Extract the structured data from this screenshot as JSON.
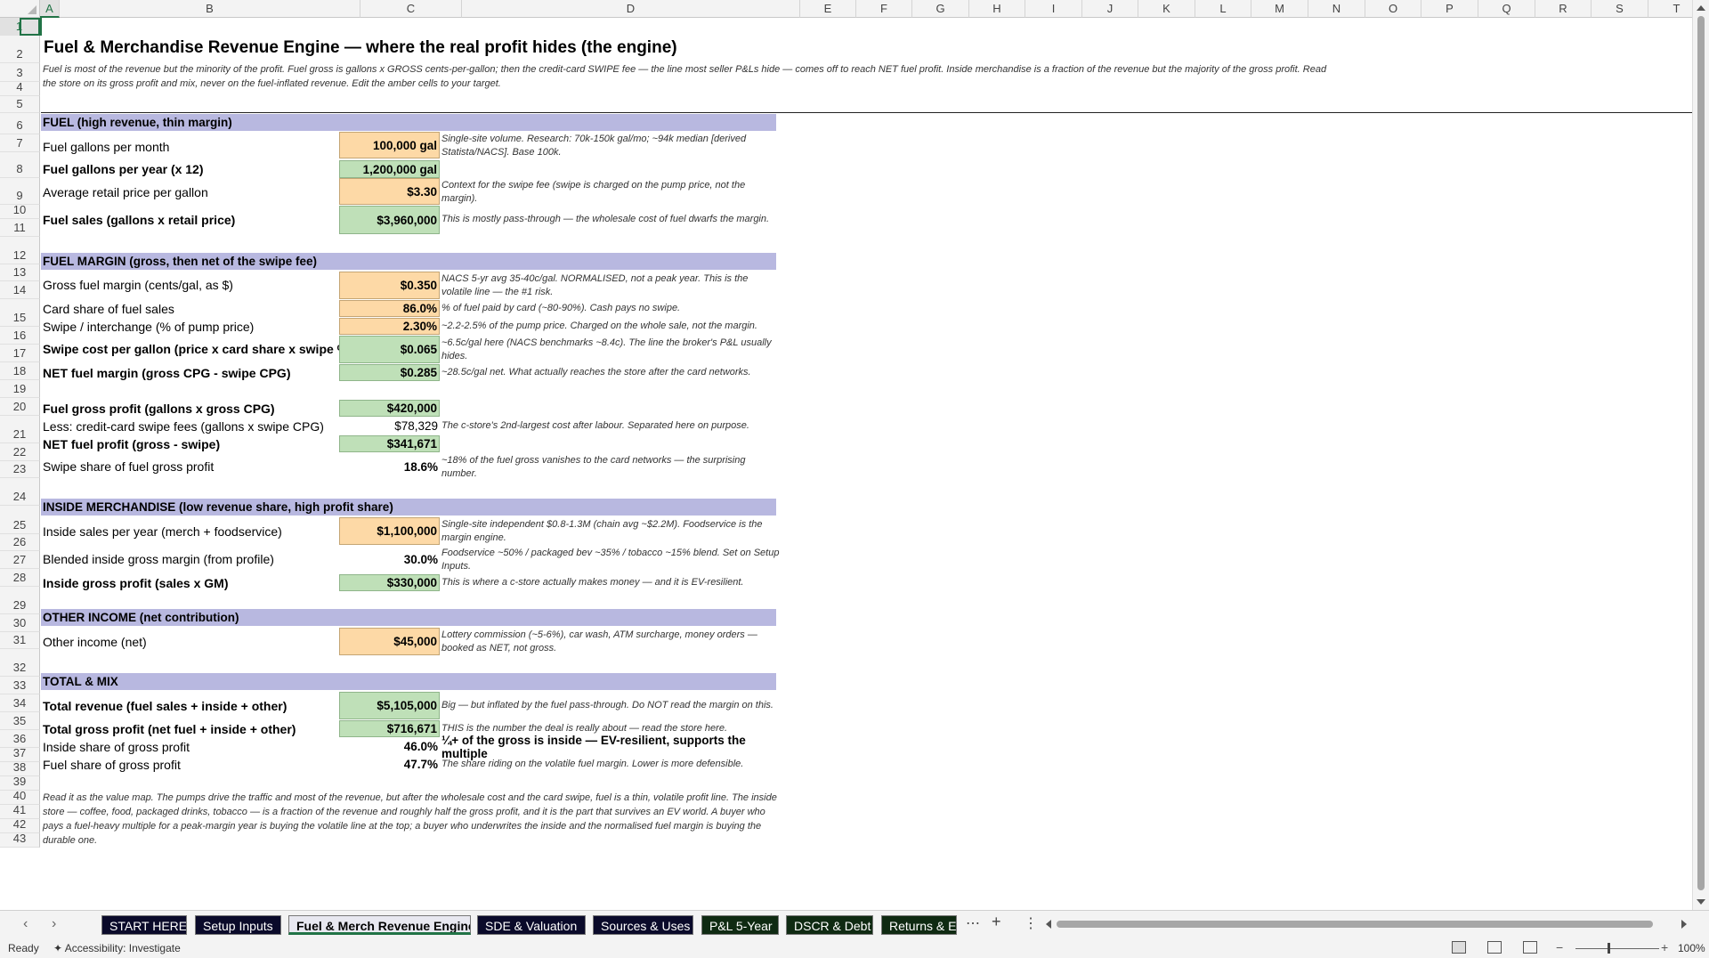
{
  "sheet": {
    "columns": [
      "A",
      "B",
      "C",
      "D",
      "E",
      "F",
      "G",
      "H",
      "I",
      "J",
      "K",
      "L",
      "M",
      "N",
      "O",
      "P",
      "Q",
      "R",
      "S",
      "T"
    ],
    "rows": [
      "1",
      "2",
      "3",
      "4",
      "5",
      "6",
      "7",
      "8",
      "9",
      "10",
      "11",
      "12",
      "13",
      "14",
      "15",
      "16",
      "17",
      "18",
      "19",
      "20",
      "21",
      "22",
      "23",
      "24",
      "25",
      "26",
      "27",
      "28",
      "29",
      "30",
      "31",
      "32",
      "33",
      "34",
      "35",
      "36",
      "37",
      "38",
      "39",
      "40",
      "41",
      "42",
      "43"
    ],
    "title": "Fuel & Merchandise Revenue Engine — where the real profit hides (the engine)",
    "subtitle": "Fuel is most of the revenue but the minority of the profit. Fuel gross is gallons x GROSS cents-per-gallon; then the credit-card SWIPE fee — the line most seller P&Ls hide — comes off to reach NET fuel profit. Inside merchandise is a fraction of the revenue but the majority of the gross profit. Read the store on its gross profit and mix, never on the fuel-inflated revenue. Edit the amber cells to your target.",
    "closing_note": "Read it as the value map. The pumps drive the traffic and most of the revenue, but after the wholesale cost and the card swipe, fuel is a thin, volatile profit line. The inside store — coffee, food, packaged drinks, tobacco — is a fraction of the revenue and roughly half the gross profit, and it is the part that survives an EV world. A buyer who pays a fuel-heavy multiple for a peak-margin year is buying the volatile line at the top; a buyer who underwrites the inside and the normalised fuel margin is buying the durable one."
  },
  "sections": {
    "fuel": "FUEL  (high revenue, thin margin)",
    "fuel_margin": "FUEL MARGIN  (gross, then net of the swipe fee)",
    "inside": "INSIDE MERCHANDISE  (low revenue share, high profit share)",
    "other": "OTHER INCOME  (net contribution)",
    "total": "TOTAL & MIX"
  },
  "rows": {
    "r6": {
      "label": "Fuel gallons per month",
      "value": "100,000 gal",
      "note": "Single-site volume. Research: 70k-150k gal/mo; ~94k median [derived Statista/NACS]. Base 100k."
    },
    "r7": {
      "label": "Fuel gallons per year (x 12)",
      "value": "1,200,000 gal",
      "note": ""
    },
    "r8": {
      "label": "Average retail price per gallon",
      "value": "$3.30",
      "note": "Context for the swipe fee (swipe is charged on the pump price, not the margin)."
    },
    "r9": {
      "label": "Fuel sales (gallons x retail price)",
      "value": "$3,960,000",
      "note": "This is mostly pass-through — the wholesale cost of fuel dwarfs the margin."
    },
    "r12": {
      "label": "Gross fuel margin (cents/gal, as $)",
      "value": "$0.350",
      "note": "NACS 5-yr avg 35-40c/gal. NORMALISED, not a peak year. This is the volatile line — the #1 risk."
    },
    "r13": {
      "label": "Card share of fuel sales",
      "value": "86.0%",
      "note": "% of fuel paid by card (~80-90%). Cash pays no swipe."
    },
    "r14": {
      "label": "Swipe / interchange (% of pump price)",
      "value": "2.30%",
      "note": "~2.2-2.5% of the pump price. Charged on the whole sale, not the margin."
    },
    "r15": {
      "label": "Swipe cost per gallon (price x card share x swipe %)",
      "value": "$0.065",
      "note": "~6.5c/gal here (NACS benchmarks ~8.4c). The line the broker's P&L usually hides."
    },
    "r16": {
      "label": "NET fuel margin (gross CPG - swipe CPG)",
      "value": "$0.285",
      "note": "~28.5c/gal net. What actually reaches the store after the card networks."
    },
    "r18": {
      "label": "Fuel gross profit (gallons x gross CPG)",
      "value": "$420,000",
      "note": ""
    },
    "r19": {
      "label": "Less: credit-card swipe fees (gallons x swipe CPG)",
      "value": "$78,329",
      "note": "The c-store's 2nd-largest cost after labour. Separated here on purpose."
    },
    "r20": {
      "label": "NET fuel profit (gross - swipe)",
      "value": "$341,671",
      "note": ""
    },
    "r21": {
      "label": "Swipe share of fuel gross profit",
      "value": "18.6%",
      "note": "~18% of the fuel gross vanishes to the card networks — the surprising number."
    },
    "r24": {
      "label": "Inside sales per year (merch + foodservice)",
      "value": "$1,100,000",
      "note": "Single-site independent $0.8-1.3M (chain avg ~$2.2M). Foodservice is the margin engine."
    },
    "r25": {
      "label": "Blended inside gross margin (from profile)",
      "value": "30.0%",
      "note": "Foodservice ~50% / packaged bev ~35% / tobacco ~15% blend. Set on Setup Inputs."
    },
    "r26": {
      "label": "Inside gross profit (sales x GM)",
      "value": "$330,000",
      "note": "This is where a c-store actually makes money — and it is EV-resilient."
    },
    "r29": {
      "label": "Other income (net)",
      "value": "$45,000",
      "note": "Lottery commission (~5-6%), car wash, ATM surcharge, money orders — booked as NET, not gross."
    },
    "r32": {
      "label": "Total revenue (fuel sales + inside + other)",
      "value": "$5,105,000",
      "note": "Big — but inflated by the fuel pass-through. Do NOT read the margin on this."
    },
    "r33": {
      "label": "Total gross profit (net fuel + inside + other)",
      "value": "$716,671",
      "note": "THIS is the number the deal is really about — read the store here."
    },
    "r34": {
      "label": "Inside share of gross profit",
      "value": "46.0%",
      "note": "¼+ of the gross is inside — EV-resilient, supports the multiple"
    },
    "r35": {
      "label": "Fuel share of gross profit",
      "value": "47.7%",
      "note": "The share riding on the volatile fuel margin. Lower is more defensible."
    }
  },
  "tabs": [
    {
      "label": "START HERE",
      "color": "#0a0a2a"
    },
    {
      "label": "Setup Inputs",
      "color": "#0a0a2a"
    },
    {
      "label": "Fuel & Merch Revenue Engine",
      "color": "#e8e8f0"
    },
    {
      "label": "SDE & Valuation",
      "color": "#0a0a2a"
    },
    {
      "label": "Sources & Uses",
      "color": "#0a0a2a"
    },
    {
      "label": "P&L 5-Year",
      "color": "#0f2a12"
    },
    {
      "label": "DSCR & Debt",
      "color": "#0f2a12"
    },
    {
      "label": "Returns & E",
      "color": "#0f2a12"
    }
  ],
  "status": {
    "ready": "Ready",
    "accessibility": "Accessibility: Investigate",
    "zoom": "100%"
  },
  "colors": {
    "input": "#fdd9a6",
    "calc": "#bfe0b8",
    "section": "#b8b8e0",
    "accent": "#217346"
  }
}
